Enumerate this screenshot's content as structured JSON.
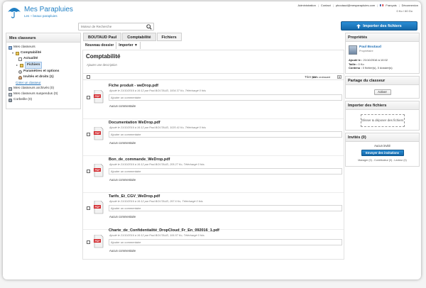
{
  "topbar": {
    "admin": "Administration",
    "contact": "Contact",
    "email": "pboutaud@mesparapluies.com",
    "language": "Français",
    "logout": "Déconnexion"
  },
  "quota": "0 Ko / 60 Go",
  "brand": {
    "title": "Mes Parapluies",
    "links": "Les ~ beaux parapluies"
  },
  "search": {
    "placeholder": "Moteur de Recherche"
  },
  "import_button": "Importer des fichiers",
  "left": {
    "title": "Mes classeurs",
    "items": {
      "root": "Mes classeurs",
      "comptabilite": "Comptabilité",
      "actualite": "Actualité",
      "fichiers": "Fichiers",
      "parametres": "Paramètres et options",
      "invites": "Invités et droits (1)",
      "create": "Créer un classeur",
      "archives": "Mes classeurs archivés (0)",
      "suspendus": "Mes classeurs suspendus (0)",
      "corbeille": "Corbeille (0)"
    }
  },
  "breadcrumb": [
    "BOUTAUD Paul",
    "Comptabilité",
    "Fichiers"
  ],
  "actions": {
    "new_folder": "Nouveau dossier",
    "import": "Importer ▼"
  },
  "main": {
    "title": "Comptabilité",
    "description": "Ajouter une description",
    "sort_label": "Trier par",
    "sort_value": "Nom croissant",
    "comment_placeholder": "Ajouter un commentaire",
    "no_comment": "Aucun commentaire",
    "files": [
      {
        "name": "Fiche produit - weDrop.pdf",
        "meta": "Ajouté le 21/10/2016 à 16:12 par Paul BOUTAUD, 1004.37 Ko, Téléchargé 0 fois"
      },
      {
        "name": "Documentation WeDrop.pdf",
        "meta": "Ajouté le 21/10/2016 à 16:12 par Paul BOUTAUD, 1020.41 Ko, Téléchargé 0 fois"
      },
      {
        "name": "Bon_de_commande_WeDrop.pdf",
        "meta": "Ajouté le 21/10/2016 à 16:12 par Paul BOUTAUD, 205.27 Ko, Téléchargé 0 fois"
      },
      {
        "name": "Tarifs_Et_CGV_WeDrop.pdf",
        "meta": "Ajouté le 21/10/2016 à 16:12 par Paul BOUTAUD, 297.6 Ko, Téléchargé 0 fois"
      },
      {
        "name": "Charte_de_Confidentialité_DropCloud_Fr_En_092016_1.pdf",
        "meta": "Ajouté le 21/10/2016 à 16:12 par Paul BOUTAUD, 106.57 Ko, Téléchargé 0 fois"
      }
    ]
  },
  "properties": {
    "title": "Propriétés",
    "user": "Paul Boutaud",
    "role": "Propriétaire",
    "added_label": "Ajouté le :",
    "added_value": "21/10/2016 à 10:02",
    "size_label": "Taille :",
    "size_value": "0 Ko",
    "contents_label": "Contenu :",
    "contents_value": "0 fichier(s), 0 dossier(s)"
  },
  "share": {
    "title": "Partage du classeur",
    "button": "Activer"
  },
  "import_panel": {
    "title": "Importer des fichiers",
    "dropzone": "Glisser & déposer des fichiers"
  },
  "invites": {
    "title": "Invités (0)",
    "none": "Aucun invité",
    "button": "Envoyer des invitations",
    "roles": "Manager (0) - Contributeur (0) - Lecteur (0)"
  }
}
